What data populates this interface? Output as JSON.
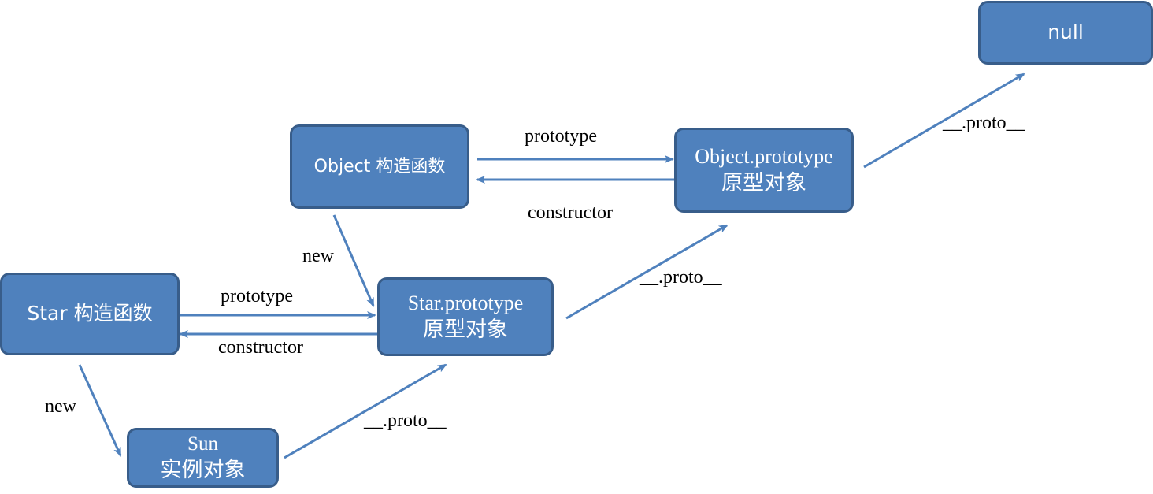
{
  "nodes": {
    "null": {
      "line1": "null"
    },
    "object_ctor": {
      "line1": "Object 构造函数"
    },
    "object_proto": {
      "line1": "Object.prototype",
      "line2": "原型对象"
    },
    "star_ctor": {
      "line1": "Star 构造函数"
    },
    "star_proto": {
      "line1": "Star.prototype",
      "line2": "原型对象"
    },
    "sun": {
      "line1": "Sun",
      "line2": "实例对象"
    }
  },
  "edges": {
    "object_prototype": "prototype",
    "object_constructor": "constructor",
    "object_new": "new",
    "star_prototype": "prototype",
    "star_constructor": "constructor",
    "star_new": "new",
    "sun_proto": "__.proto__",
    "star_proto_proto": "__.proto__",
    "object_proto_proto": "__.proto__"
  },
  "colors": {
    "node_fill": "#4f81bd",
    "node_border": "#385d8a",
    "arrow": "#4f81bd",
    "node_text": "#ffffff",
    "label_text": "#000000"
  }
}
